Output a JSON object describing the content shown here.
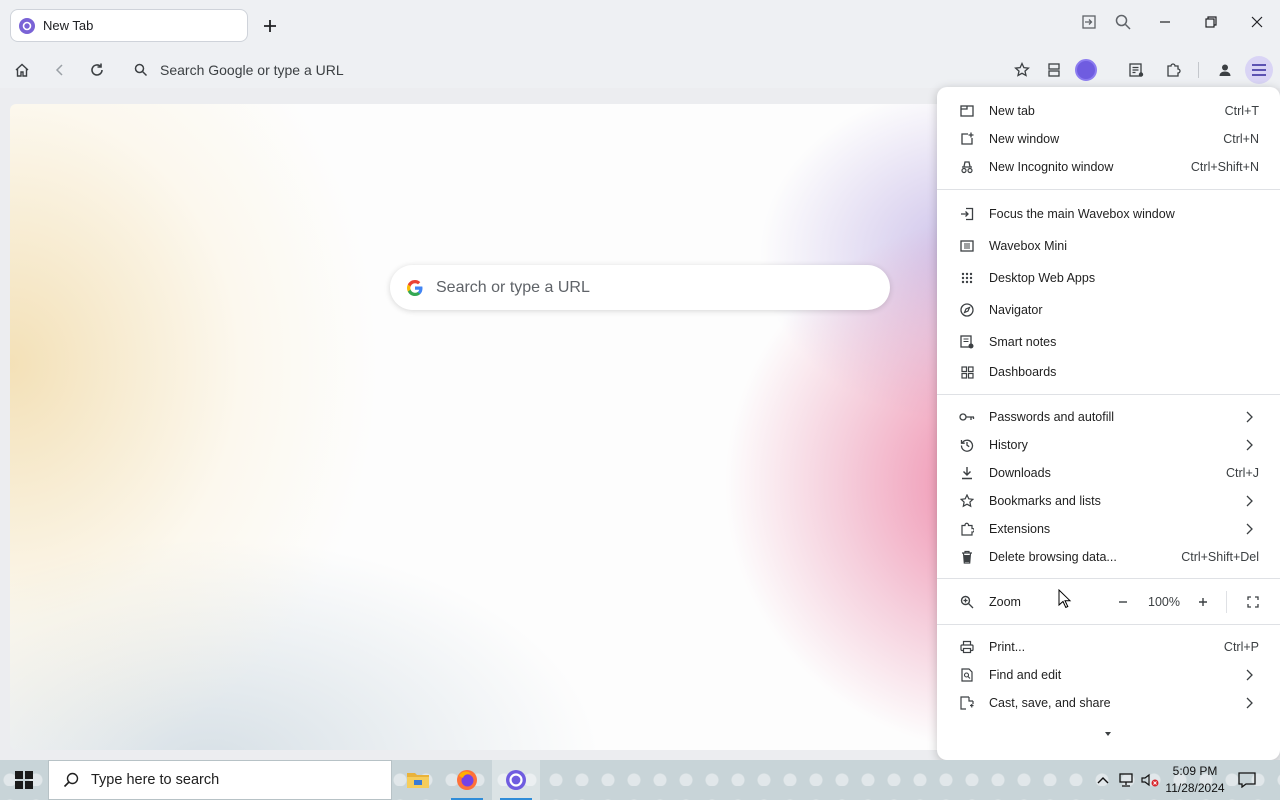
{
  "tab": {
    "title": "New Tab"
  },
  "toolbar": {
    "omnibox_placeholder": "Search Google or type a URL"
  },
  "page": {
    "search_placeholder": "Search or type a URL"
  },
  "menu": {
    "items": [
      {
        "label": "New tab",
        "shortcut": "Ctrl+T",
        "icon": "new-tab-icon"
      },
      {
        "label": "New window",
        "shortcut": "Ctrl+N",
        "icon": "new-window-icon"
      },
      {
        "label": "New Incognito window",
        "shortcut": "Ctrl+Shift+N",
        "icon": "incognito-icon"
      },
      {
        "label": "Focus the main Wavebox window",
        "icon": "focus-window-icon"
      },
      {
        "label": "Wavebox Mini",
        "icon": "mini-icon"
      },
      {
        "label": "Desktop Web Apps",
        "icon": "apps-grid-icon"
      },
      {
        "label": "Navigator",
        "icon": "compass-icon"
      },
      {
        "label": "Smart notes",
        "icon": "notes-icon"
      },
      {
        "label": "Dashboards",
        "icon": "dashboard-icon"
      },
      {
        "label": "Passwords and autofill",
        "icon": "key-icon"
      },
      {
        "label": "History",
        "icon": "history-icon"
      },
      {
        "label": "Downloads",
        "shortcut": "Ctrl+J",
        "icon": "download-icon"
      },
      {
        "label": "Bookmarks and lists",
        "icon": "star-icon"
      },
      {
        "label": "Extensions",
        "icon": "puzzle-icon"
      },
      {
        "label": "Delete browsing data...",
        "shortcut": "Ctrl+Shift+Del",
        "icon": "trash-icon"
      },
      {
        "label": "Print...",
        "shortcut": "Ctrl+P",
        "icon": "print-icon"
      },
      {
        "label": "Find and edit",
        "icon": "find-icon"
      },
      {
        "label": "Cast, save, and share",
        "icon": "cast-icon"
      }
    ],
    "zoom": {
      "label": "Zoom",
      "value": "100%"
    }
  },
  "taskbar": {
    "search_placeholder": "Type here to search",
    "time": "5:09 PM",
    "date": "11/28/2024"
  },
  "colors": {
    "accent": "#6f5ce0",
    "menu_bg": "#ffffff",
    "chrome_bg": "#eef0f3"
  }
}
